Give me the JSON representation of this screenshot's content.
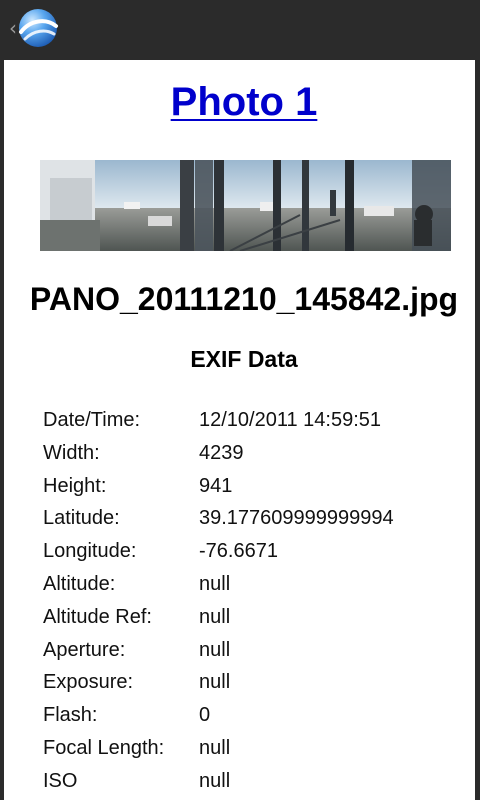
{
  "app": {
    "logo_icon": "google-earth-logo-icon",
    "up_icon": "chevron-left-icon"
  },
  "photo": {
    "title": "Photo 1",
    "filename": "PANO_20111210_145842.jpg",
    "image_icon": "panorama-photo"
  },
  "exif": {
    "heading": "EXIF Data",
    "rows": [
      {
        "label": "Date/Time:",
        "value": "12/10/2011 14:59:51"
      },
      {
        "label": "Width:",
        "value": "4239"
      },
      {
        "label": "Height:",
        "value": "941"
      },
      {
        "label": "Latitude:",
        "value": "39.177609999999994"
      },
      {
        "label": "Longitude:",
        "value": "-76.6671"
      },
      {
        "label": "Altitude:",
        "value": "null"
      },
      {
        "label": "Altitude Ref:",
        "value": "null"
      },
      {
        "label": "Aperture:",
        "value": "null"
      },
      {
        "label": "Exposure:",
        "value": "null"
      },
      {
        "label": "Flash:",
        "value": "0"
      },
      {
        "label": "Focal Length:",
        "value": "null"
      },
      {
        "label": "ISO",
        "value": "null"
      }
    ]
  },
  "colors": {
    "action_bar": "#2b2b2b",
    "title_link": "#0000cc"
  }
}
